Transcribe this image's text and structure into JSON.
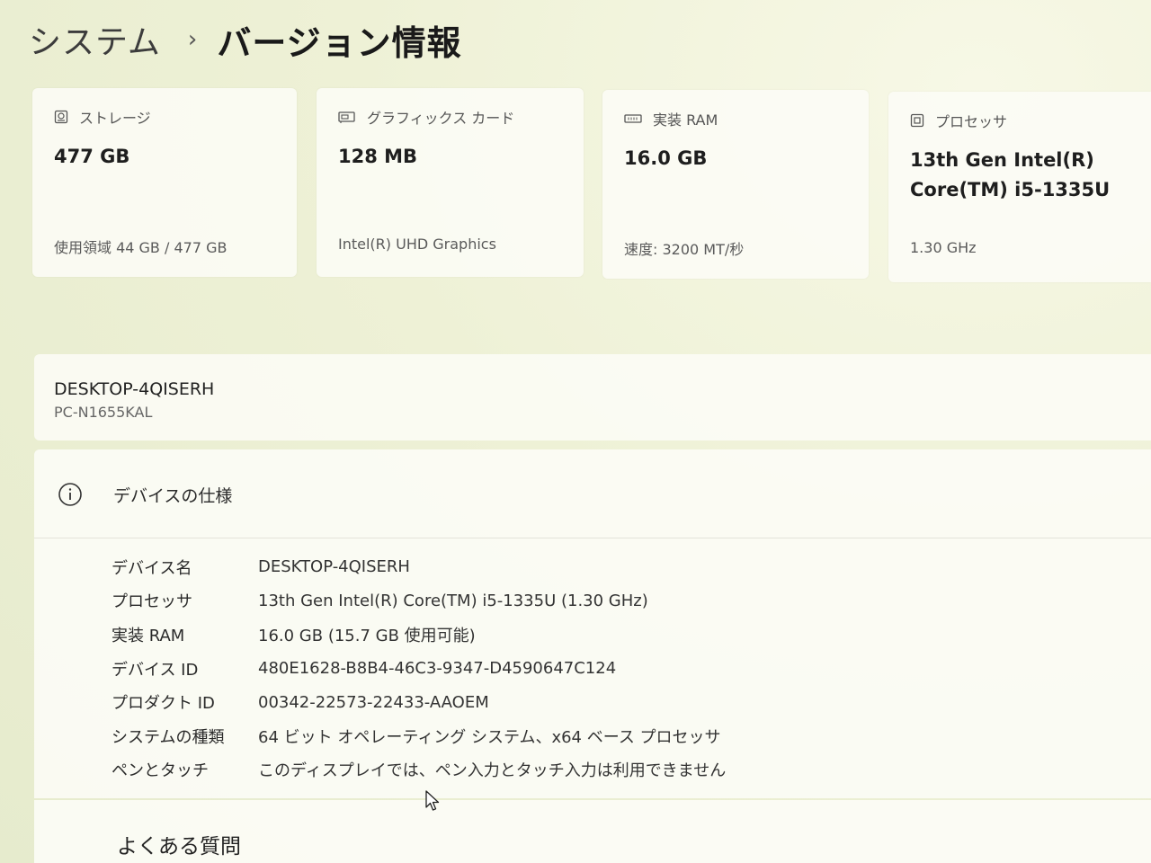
{
  "breadcrumb": {
    "parent": "システム",
    "separator": "›",
    "current": "バージョン情報"
  },
  "cards": [
    {
      "icon": "storage-icon",
      "label": "ストレージ",
      "value": "477 GB",
      "detail": "使用領域 44 GB / 477 GB"
    },
    {
      "icon": "graphics-card-icon",
      "label": "グラフィックス カード",
      "value": "128 MB",
      "detail": "Intel(R) UHD Graphics"
    },
    {
      "icon": "ram-icon",
      "label": "実装 RAM",
      "value": "16.0 GB",
      "detail": "速度: 3200 MT/秒"
    },
    {
      "icon": "processor-icon",
      "label": "プロセッサ",
      "value_line1": "13th Gen Intel(R)",
      "value_line2": "Core(TM) i5-1335U",
      "detail": "1.30 GHz"
    }
  ],
  "device": {
    "name": "DESKTOP-4QISERH",
    "model": "PC-N1655KAL"
  },
  "specs": {
    "title": "デバイスの仕様",
    "rows": [
      {
        "label": "デバイス名",
        "value": "DESKTOP-4QISERH"
      },
      {
        "label": "プロセッサ",
        "value": "13th Gen Intel(R) Core(TM) i5-1335U (1.30 GHz)"
      },
      {
        "label": "実装 RAM",
        "value": "16.0 GB (15.7 GB 使用可能)"
      },
      {
        "label": "デバイス ID",
        "value": "480E1628-B8B4-46C3-9347-D4590647C124"
      },
      {
        "label": "プロダクト ID",
        "value": "00342-22573-22433-AAOEM"
      },
      {
        "label": "システムの種類",
        "value": "64 ビット オペレーティング システム、x64 ベース プロセッサ"
      },
      {
        "label": "ペンとタッチ",
        "value": "このディスプレイでは、ペン入力とタッチ入力は利用できません"
      }
    ]
  },
  "faq": {
    "title": "よくある質問"
  }
}
